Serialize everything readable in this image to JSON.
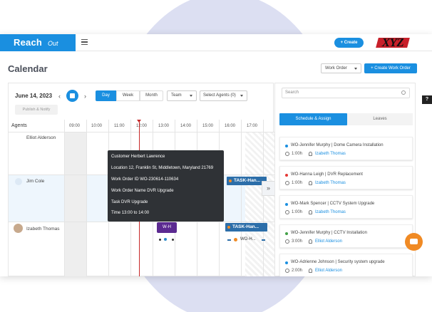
{
  "brand": {
    "logo_main": "Reach",
    "logo_sub": "Out",
    "client_logo": "XYZ"
  },
  "header": {
    "create_label": "+ Create"
  },
  "page": {
    "title": "Calendar",
    "order_select": "Work Order",
    "create_work_order": "+ Create Work Order"
  },
  "calendar": {
    "date": "June 14, 2023",
    "prev": "‹",
    "next": "›",
    "views": {
      "day": "Day",
      "week": "Week",
      "month": "Month"
    },
    "team_select": "Team",
    "agents_select": "Select Agents (0)",
    "publish": "Publish & Notify",
    "agents_header": "Agents",
    "hours": [
      "09:00",
      "10:00",
      "11:00",
      "12:00",
      "13:00",
      "14:00",
      "15:00",
      "16:00",
      "17:00"
    ],
    "agents": [
      {
        "name": "Elliot Alderson"
      },
      {
        "name": "Jim Cole"
      },
      {
        "name": "Izabeth Thomas"
      }
    ],
    "tasks": [
      {
        "label": "TASK-Han..."
      },
      {
        "label": "TASK-Han..."
      }
    ],
    "purple_label": "W-H",
    "wo_h_label": "WO-H...",
    "expand": "»"
  },
  "tooltip": {
    "customer": "Customer  Herbert Lawrence",
    "location": "Location  12, Franklin St, Middletown, Maryland 21769",
    "wo_id": "Work Order ID  WO-230614-110634",
    "wo_name": "Work Order Name  DVR Upgrade",
    "task": "Task  DVR Upgrade",
    "time": "Time  13:00 to 14:00"
  },
  "side": {
    "search_placeholder": "Search",
    "tab_schedule": "Schedule & Assign",
    "tab_leaves": "Leaves",
    "work_orders": [
      {
        "title": "WO-Jennifer Murphy | Dome Camera Installation",
        "duration": "1:00h",
        "agent": "Izabeth Thomas",
        "dot_color": "#1a8fe0"
      },
      {
        "title": "WO-Hanna Leigh | DVR Replacement",
        "duration": "1:00h",
        "agent": "Izabeth Thomas",
        "dot_color": "#e53935"
      },
      {
        "title": "WO-Mark Spencer | CCTV System Upgrade",
        "duration": "1:00h",
        "agent": "Izabeth Thomas",
        "dot_color": "#1a8fe0"
      },
      {
        "title": "WO-Jennifer Murphy | CCTV Installation",
        "duration": "3:00h",
        "agent": "Elliot Alderson",
        "dot_color": "#43a047"
      },
      {
        "title": "WO-Adrienne Johnson | Security system upgrade",
        "duration": "2:00h",
        "agent": "Elliot Alderson",
        "dot_color": "#1a8fe0"
      }
    ]
  },
  "help": "?"
}
